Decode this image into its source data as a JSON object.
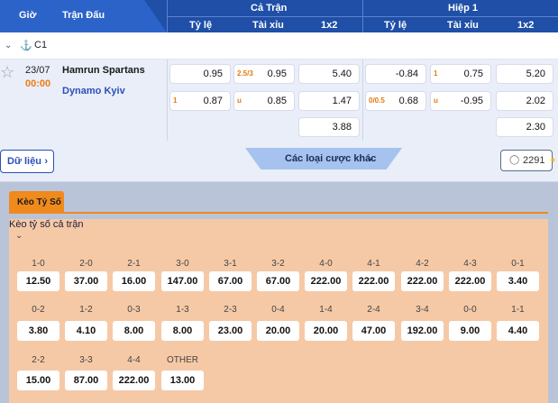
{
  "header": {
    "time_col": "Giờ",
    "match_col": "Trận Đấu",
    "full_match": "Cả Trận",
    "half1": "Hiệp 1",
    "handicap": "Tỷ lệ",
    "over_under": "Tài xỉu",
    "one_x_two": "1x2"
  },
  "league": {
    "name": "C1"
  },
  "match": {
    "date": "23/07",
    "time": "00:00",
    "home": "Hamrun Spartans",
    "away": "Dynamo Kyiv",
    "ft_handicap": [
      {
        "line": "",
        "odd": "0.95"
      },
      {
        "line": "1",
        "odd": "0.87"
      }
    ],
    "ft_ou": [
      {
        "line": "2.5/3",
        "odd": "0.95"
      },
      {
        "line": "u",
        "odd": "0.85"
      }
    ],
    "ft_1x2": [
      "5.40",
      "1.47",
      "3.88"
    ],
    "h1_handicap": [
      {
        "line": "",
        "odd": "-0.84"
      },
      {
        "line": "0/0.5",
        "odd": "0.68"
      }
    ],
    "h1_ou": [
      {
        "line": "1",
        "odd": "0.75"
      },
      {
        "line": "u",
        "odd": "-0.95"
      }
    ],
    "h1_1x2": [
      "5.20",
      "2.02",
      "2.30"
    ],
    "data_button": "Dữ liệu",
    "more_bets": "Các loại cược khác",
    "viewer_count": "2291"
  },
  "correct_score": {
    "tab": "Kèo Tỷ Số",
    "title": "Kèo tỷ số cả trận",
    "rows": [
      [
        {
          "s": "1-0",
          "o": "12.50"
        },
        {
          "s": "2-0",
          "o": "37.00"
        },
        {
          "s": "2-1",
          "o": "16.00"
        },
        {
          "s": "3-0",
          "o": "147.00"
        },
        {
          "s": "3-1",
          "o": "67.00"
        },
        {
          "s": "3-2",
          "o": "67.00"
        },
        {
          "s": "4-0",
          "o": "222.00"
        },
        {
          "s": "4-1",
          "o": "222.00"
        },
        {
          "s": "4-2",
          "o": "222.00"
        },
        {
          "s": "4-3",
          "o": "222.00"
        },
        {
          "s": "0-1",
          "o": "3.40"
        }
      ],
      [
        {
          "s": "0-2",
          "o": "3.80"
        },
        {
          "s": "1-2",
          "o": "4.10"
        },
        {
          "s": "0-3",
          "o": "8.00"
        },
        {
          "s": "1-3",
          "o": "8.00"
        },
        {
          "s": "2-3",
          "o": "23.00"
        },
        {
          "s": "0-4",
          "o": "20.00"
        },
        {
          "s": "1-4",
          "o": "20.00"
        },
        {
          "s": "2-4",
          "o": "47.00"
        },
        {
          "s": "3-4",
          "o": "192.00"
        },
        {
          "s": "0-0",
          "o": "9.00"
        },
        {
          "s": "1-1",
          "o": "4.40"
        }
      ],
      [
        {
          "s": "2-2",
          "o": "15.00"
        },
        {
          "s": "3-3",
          "o": "87.00"
        },
        {
          "s": "4-4",
          "o": "222.00"
        },
        {
          "s": "OTHER",
          "o": "13.00"
        }
      ]
    ]
  },
  "colors": {
    "header_bg": "#1f4fa7",
    "accent_orange": "#f08a1c",
    "panel_bg": "#f6c9a6"
  }
}
